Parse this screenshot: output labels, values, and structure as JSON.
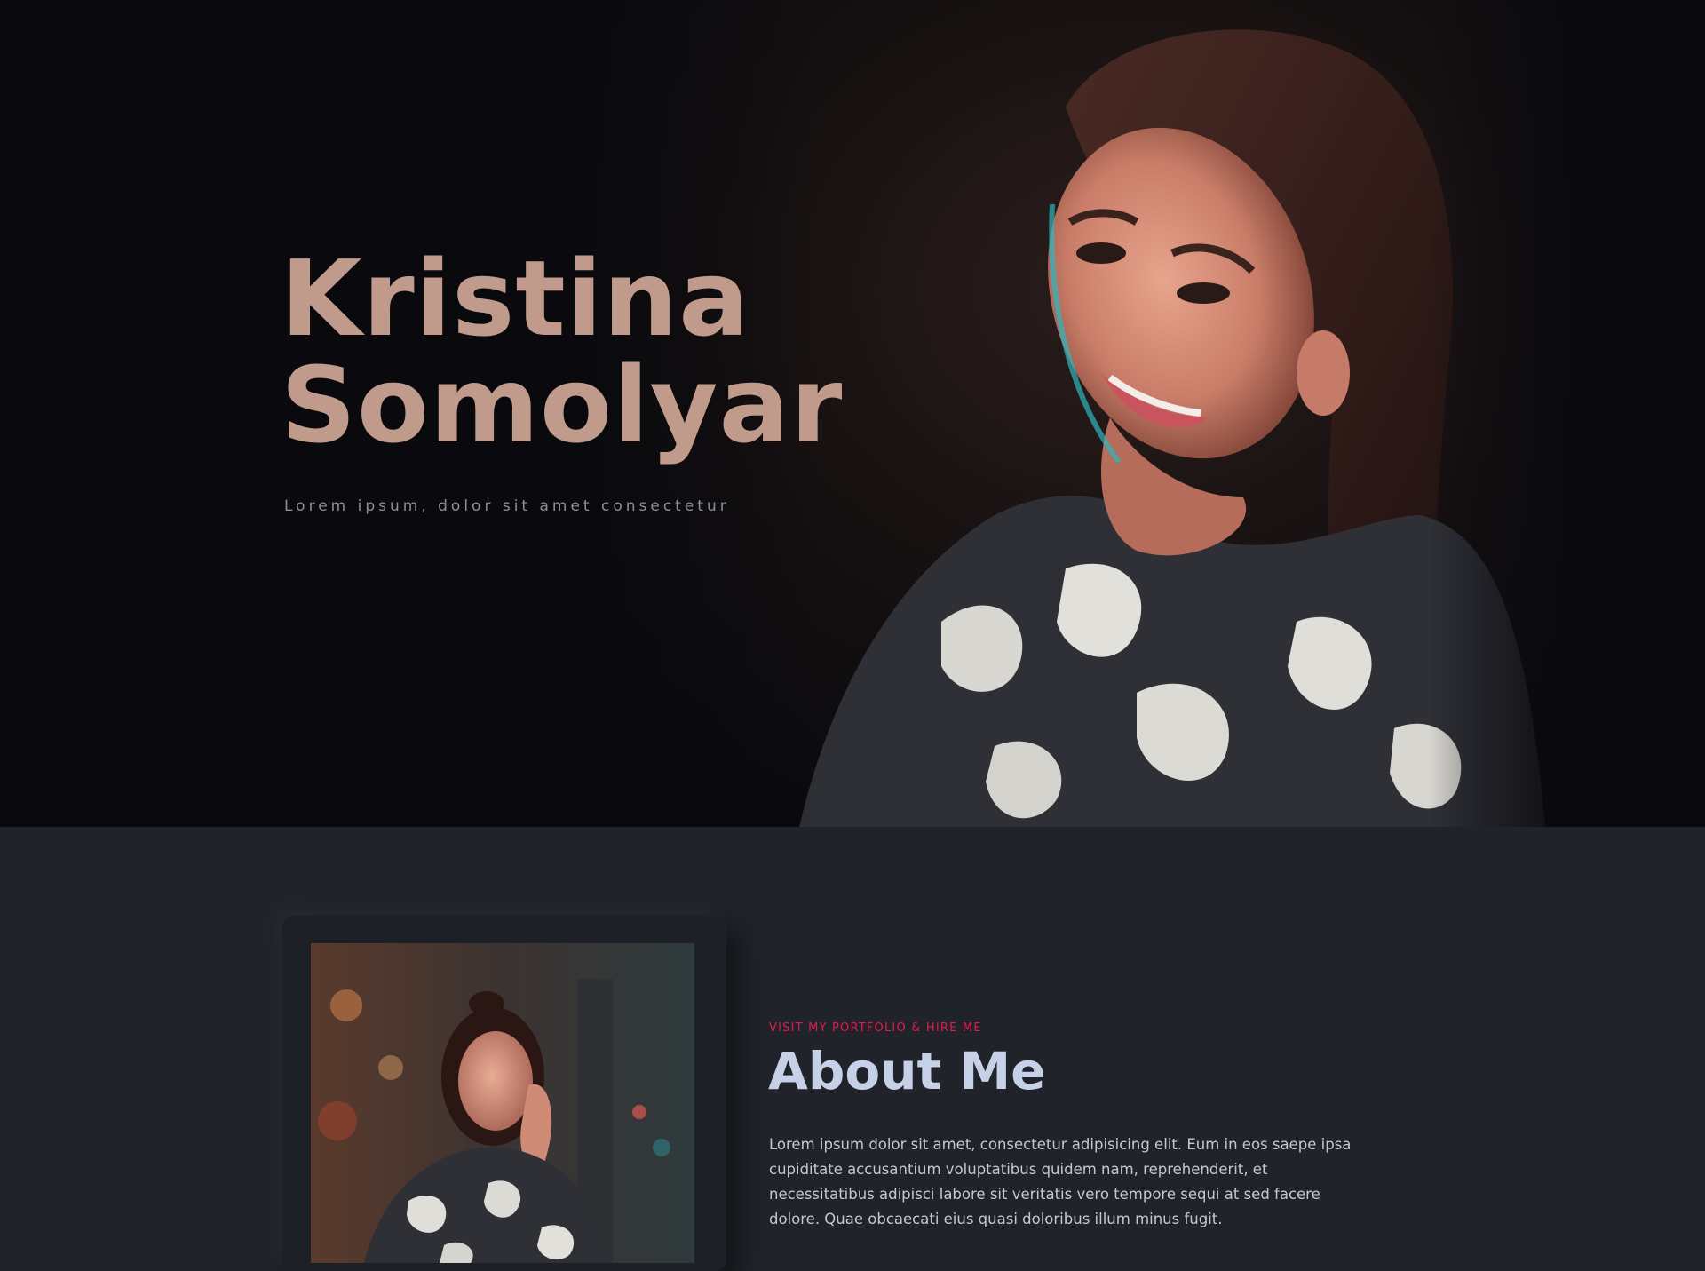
{
  "hero": {
    "name_line1": "Kristina",
    "name_line2": "Somolyar",
    "tagline": "Lorem ipsum, dolor sit amet consectetur"
  },
  "about": {
    "eyebrow": "VISIT MY PORTFOLIO & HIRE ME",
    "title": "About Me",
    "text": "Lorem ipsum dolor sit amet, consectetur adipisicing elit. Eum in eos saepe ipsa cupiditate accusantium voluptatibus quidem nam, reprehenderit, et necessitatibus adipisci labore sit veritatis vero tempore sequi at sed facere dolore. Quae obcaecati eius quasi doloribus illum minus fugit."
  },
  "colors": {
    "hero_background": "#0a0a0e",
    "section_background": "#20232a",
    "name_color": "#c09b8b",
    "eyebrow_color": "#e2194f",
    "title_color": "#c6d0e6"
  }
}
